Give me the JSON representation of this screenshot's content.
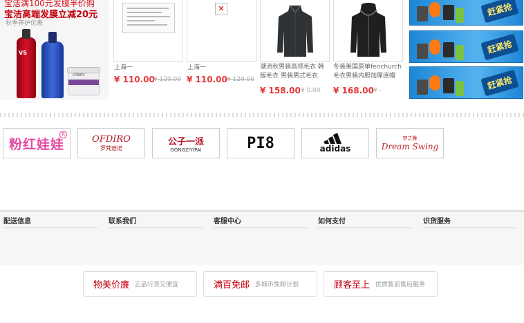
{
  "promo": {
    "line1": "宝洁满100元发膜半价购",
    "line2": "宝洁高端发膜立减20元",
    "line3": "秋季养护优惠",
    "brand_label": "VS",
    "jar_label": "OWAY"
  },
  "products": [
    {
      "title": "上海一",
      "price": "¥ 110.00",
      "old_price": "¥ 120.00",
      "image": "document-thumbnail"
    },
    {
      "title": "上海一",
      "price": "¥ 110.00",
      "old_price": "¥ 120.00",
      "image": "broken-image-icon"
    },
    {
      "title": "潮流秋男装高领毛衣 韩版毛衣 男装男式毛衣",
      "price": "¥ 158.00",
      "old_price": "¥ 0.00",
      "image": "black-sweater"
    },
    {
      "title": "冬装美国原单fenchurch毛衣男装内胆加厚连帽",
      "price": "¥ 168.00",
      "old_price": "¥ -",
      "image": "black-hoodie"
    }
  ],
  "grab_ads": [
    {
      "label": "赶紧抢"
    },
    {
      "label": "赶紧抢"
    },
    {
      "label": "赶紧抢"
    }
  ],
  "brands": [
    {
      "name": "粉红娃娃",
      "color": "#e64aa0"
    },
    {
      "name": "OFDIRO",
      "sub": "罗梵迪诺",
      "color": "#b31c24"
    },
    {
      "name": "公子一派",
      "sub": "GONGZIYIPAI",
      "color": "#b31c24"
    },
    {
      "name": "PI8",
      "color": "#111111"
    },
    {
      "name": "adidas",
      "color": "#111111"
    },
    {
      "name": "Dream Swing",
      "sub": "梦之舞",
      "color": "#c0252d"
    }
  ],
  "info_columns": [
    "配送信息",
    "联系我们",
    "客服中心",
    "如何支付",
    "识货服务"
  ],
  "services": [
    {
      "title": "物美价廉",
      "subtitle": "正品行货又便宜"
    },
    {
      "title": "满百免邮",
      "subtitle": "多城市免邮计划"
    },
    {
      "title": "顾客至上",
      "subtitle": "优质售前售后服务"
    }
  ],
  "colors": {
    "price_red": "#e4393c",
    "accent_red": "#c5000d",
    "ad_blue": "#1e86d6"
  }
}
